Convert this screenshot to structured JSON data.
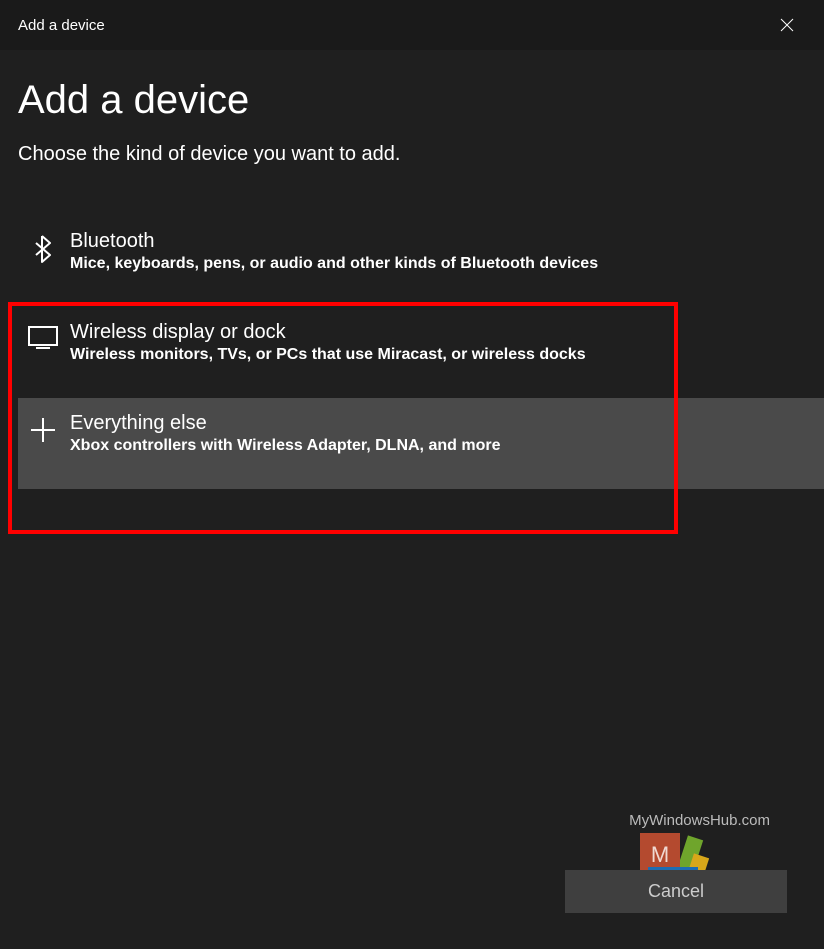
{
  "titlebar": {
    "title": "Add a device"
  },
  "header": {
    "title": "Add a device",
    "subtitle": "Choose the kind of device you want to add."
  },
  "options": [
    {
      "id": "bluetooth",
      "title": "Bluetooth",
      "description": "Mice, keyboards, pens, or audio and other kinds of Bluetooth devices",
      "hovered": false
    },
    {
      "id": "wireless-display",
      "title": "Wireless display or dock",
      "description": "Wireless monitors, TVs, or PCs that use Miracast, or wireless docks",
      "hovered": false
    },
    {
      "id": "everything-else",
      "title": "Everything else",
      "description": "Xbox controllers with Wireless Adapter, DLNA, and more",
      "hovered": true
    }
  ],
  "footer": {
    "cancel_label": "Cancel"
  },
  "watermark": {
    "text": "MyWindowsHub.com"
  }
}
